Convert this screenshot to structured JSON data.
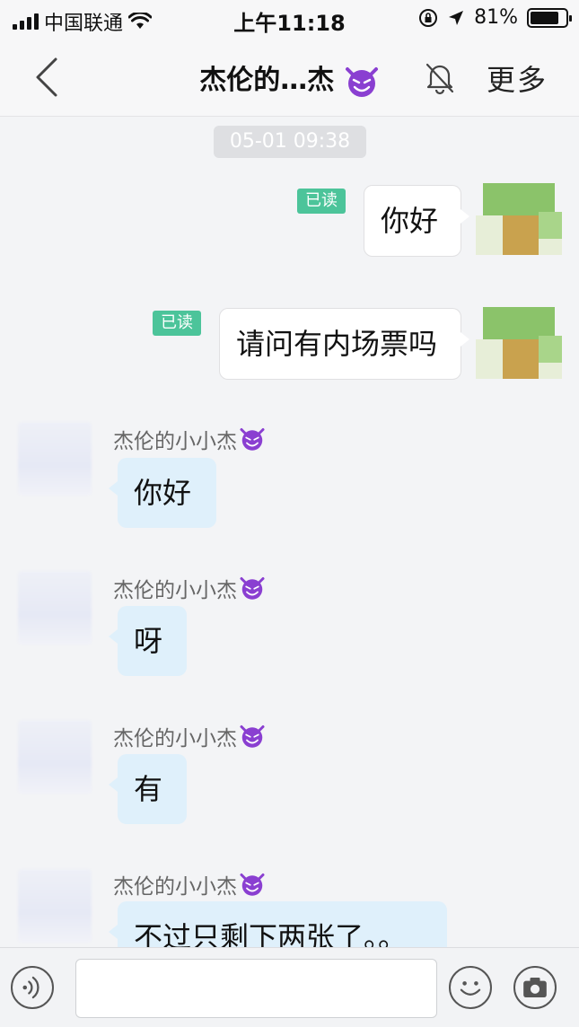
{
  "status_bar": {
    "carrier": "中国联通",
    "time": "上午11:18",
    "battery_percent": "81%",
    "battery_level": 0.81,
    "icons": [
      "signal-icon",
      "wifi-icon",
      "orientation-lock-icon",
      "location-arrow-icon",
      "battery-icon"
    ]
  },
  "nav": {
    "title": "杰伦的…杰",
    "title_emoji": "devil-face-icon",
    "more_label": "更多",
    "back_icon": "chevron-left-icon",
    "mute_icon": "bell-off-icon"
  },
  "chat": {
    "timestamp": "05-01 09:38",
    "read_label": "已读",
    "sender_name": "杰伦的小小杰",
    "messages": [
      {
        "direction": "out",
        "text": "你好",
        "read": true
      },
      {
        "direction": "out",
        "text": "请问有内场票吗",
        "read": true
      },
      {
        "direction": "in",
        "sender": "杰伦的小小杰",
        "text": "你好"
      },
      {
        "direction": "in",
        "sender": "杰伦的小小杰",
        "text": "呀"
      },
      {
        "direction": "in",
        "sender": "杰伦的小小杰",
        "text": "有"
      },
      {
        "direction": "in",
        "sender": "杰伦的小小杰",
        "text": "不过只剩下两张了。。"
      }
    ]
  },
  "input_bar": {
    "placeholder": "",
    "icons": [
      "voice-icon",
      "emoji-icon",
      "camera-icon"
    ]
  },
  "colors": {
    "read_badge": "#4cc49a",
    "incoming_bubble": "#dff0fb",
    "outgoing_bubble": "#ffffff",
    "devil_purple": "#8a3fd1"
  }
}
